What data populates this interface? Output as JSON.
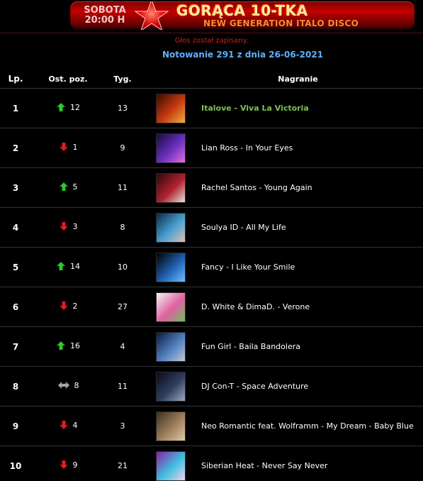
{
  "banner": {
    "day": "SOBOTA",
    "time": "20:00 H",
    "title": "GORĄCA 10-TKA",
    "subtitle": "NEW GENERATION ITALO DISCO"
  },
  "status": "Głos został zapisany.",
  "chart_date": "Notowanie 291 z dnia 26-06-2021",
  "columns": {
    "rank": "Lp.",
    "previous": "Ost. poz.",
    "weeks": "Tyg.",
    "track": "Nagranie"
  },
  "colors": {
    "up": "#2ecc2e",
    "down": "#e02020",
    "same": "#aaaaaa",
    "highlight": "#7fc050",
    "date": "#5fb0ff"
  },
  "entries": [
    {
      "rank": "1",
      "trend": "up",
      "prev": "12",
      "weeks": "13",
      "track": "Italove - Viva La Victoria",
      "cover": [
        "#3a0a00",
        "#c53a10",
        "#f0b040"
      ]
    },
    {
      "rank": "2",
      "trend": "down",
      "prev": "1",
      "weeks": "9",
      "track": "Lian Ross - In Your Eyes",
      "cover": [
        "#1a0a3a",
        "#6a30c0",
        "#e070e0"
      ]
    },
    {
      "rank": "3",
      "trend": "up",
      "prev": "5",
      "weeks": "11",
      "track": "Rachel Santos - Young Again",
      "cover": [
        "#2a0a0a",
        "#b02030",
        "#e8e0d8"
      ]
    },
    {
      "rank": "4",
      "trend": "down",
      "prev": "3",
      "weeks": "8",
      "track": "Soulya ID - All My Life",
      "cover": [
        "#0a2a4a",
        "#4aa0d0",
        "#e0c0b0"
      ]
    },
    {
      "rank": "5",
      "trend": "up",
      "prev": "14",
      "weeks": "10",
      "track": "Fancy - I Like Your Smile",
      "cover": [
        "#000000",
        "#2060b0",
        "#70c0ff"
      ]
    },
    {
      "rank": "6",
      "trend": "down",
      "prev": "2",
      "weeks": "27",
      "track": "D. White & DimaD. - Verone",
      "cover": [
        "#f4f4f4",
        "#e060a0",
        "#70c060"
      ]
    },
    {
      "rank": "7",
      "trend": "up",
      "prev": "16",
      "weeks": "4",
      "track": "Fun Girl - Baila Bandolera",
      "cover": [
        "#0a1a3a",
        "#5080c0",
        "#c0c8d8"
      ]
    },
    {
      "rank": "8",
      "trend": "same",
      "prev": "8",
      "weeks": "11",
      "track": "DJ Con-T - Space Adventure",
      "cover": [
        "#0a0a14",
        "#304060",
        "#a0a8c0"
      ]
    },
    {
      "rank": "9",
      "trend": "down",
      "prev": "4",
      "weeks": "3",
      "track": "Neo Romantic feat. Wolframm - My Dream - Baby Blue",
      "cover": [
        "#3a3020",
        "#a08060",
        "#e0c8a0"
      ]
    },
    {
      "rank": "10",
      "trend": "down",
      "prev": "9",
      "weeks": "21",
      "track": "Siberian Heat - Never Say Never",
      "cover": [
        "#8a20a0",
        "#40c0e0",
        "#f0d0f0"
      ]
    }
  ]
}
